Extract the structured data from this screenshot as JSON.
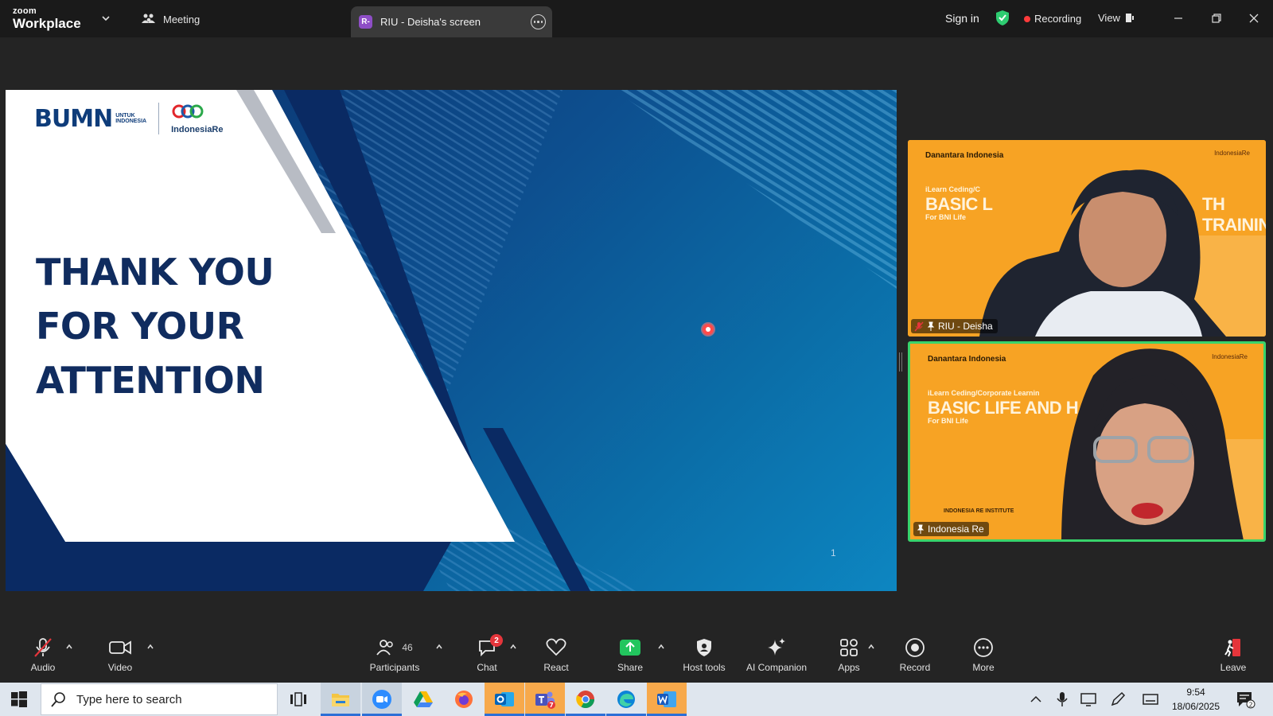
{
  "titlebar": {
    "brand_top": "zoom",
    "brand_bottom": "Workplace",
    "meeting_tab": "Meeting",
    "share_avatar": "R-",
    "share_tab": "RIU - Deisha's screen",
    "sign_in": "Sign in",
    "recording": "Recording",
    "view": "View",
    "icons": [
      "chevron-down-icon",
      "meeting-people-icon",
      "more-icon",
      "shield-check-icon",
      "view-layout-icon",
      "minimize-icon",
      "restore-icon",
      "close-icon"
    ],
    "colors": {
      "bar": "#1a1a1a",
      "shield": "#2ecc71",
      "record_dot": "#ff3b3b"
    }
  },
  "slide": {
    "logo_bumn": "BUMN",
    "logo_untuk": "UNTUK",
    "logo_indonesia": "INDONESIA",
    "logo_indonesia_re": "IndonesiaRe",
    "lines": [
      "THANK YOU",
      "FOR YOUR",
      "ATTENTION"
    ],
    "page_number": "1",
    "colors": {
      "navy": "#102c5f",
      "blue": "#0b6ea8"
    }
  },
  "participants_panel": [
    {
      "name": "RIU - Deisha",
      "muted": true,
      "pinned": true,
      "active_speaker": false,
      "bg_watermark_left": "Danantara Indonesia",
      "bg_watermark_right": "IndonesiaRe",
      "bg_subtitle": "iLearn Ceding/C",
      "bg_title": "BASIC L",
      "bg_title_end": "TH TRAINING",
      "bg_for": "For BNI Life"
    },
    {
      "name": "Indonesia Re",
      "muted": false,
      "pinned": true,
      "active_speaker": true,
      "bg_watermark_left": "Danantara Indonesia",
      "bg_watermark_right": "IndonesiaRe",
      "bg_subtitle": "iLearn Ceding/Corporate Learnin",
      "bg_title": "BASIC LIFE AND H",
      "bg_for": "For BNI Life",
      "bg_footer": "INDONESIA RE INSTITUTE"
    }
  ],
  "toolbar": {
    "audio": "Audio",
    "video": "Video",
    "participants": "Participants",
    "participants_count": "46",
    "chat": "Chat",
    "chat_badge": "2",
    "react": "React",
    "share": "Share",
    "host_tools": "Host tools",
    "ai_companion": "AI Companion",
    "apps": "Apps",
    "record": "Record",
    "more": "More",
    "leave": "Leave",
    "colors": {
      "share": "#22c55e",
      "muted": "#e5353b"
    }
  },
  "taskbar": {
    "search_placeholder": "Type here to search",
    "time": "9:54",
    "date": "18/06/2025",
    "notification_count": "2",
    "icons": [
      "windows-start-icon",
      "search-icon",
      "task-view-icon",
      "file-explorer-icon",
      "zoom-app-icon",
      "google-drive-icon",
      "firefox-icon",
      "outlook-icon",
      "teams-icon",
      "chrome-icon",
      "edge-icon",
      "word-icon",
      "chevron-up-icon",
      "microphone-icon",
      "display-icon",
      "pen-icon",
      "keyboard-icon",
      "notification-icon"
    ]
  }
}
